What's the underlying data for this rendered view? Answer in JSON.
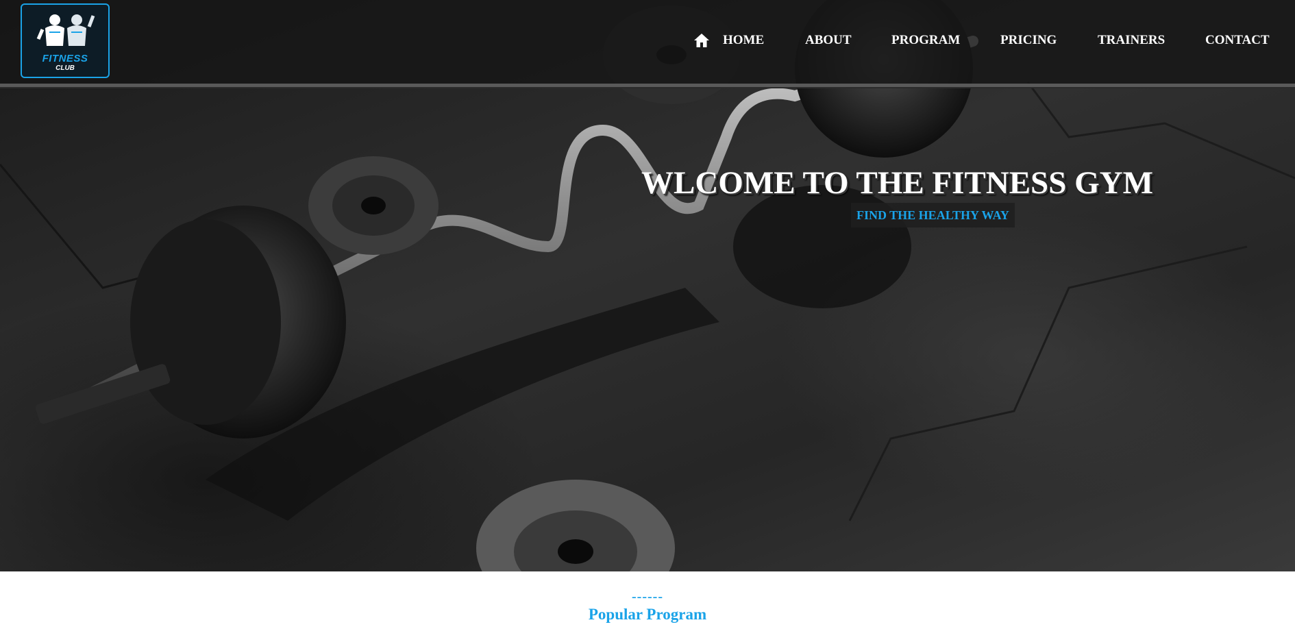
{
  "logo": {
    "line1": "FITNESS",
    "line2": "CLUB"
  },
  "nav": {
    "items": [
      {
        "label": "HOME",
        "icon": "home-icon"
      },
      {
        "label": "ABOUT"
      },
      {
        "label": "PROGRAM"
      },
      {
        "label": "PRICING"
      },
      {
        "label": "TRAINERS"
      },
      {
        "label": "CONTACT"
      }
    ]
  },
  "hero": {
    "title": "WLCOME TO THE FITNESS GYM",
    "subtitle": "FIND THE HEALTHY WAY"
  },
  "section": {
    "decoration": "------",
    "title": "Popular Program"
  },
  "colors": {
    "accent": "#1aa3e8",
    "nav_bg": "#161616",
    "text_light": "#ffffff"
  }
}
